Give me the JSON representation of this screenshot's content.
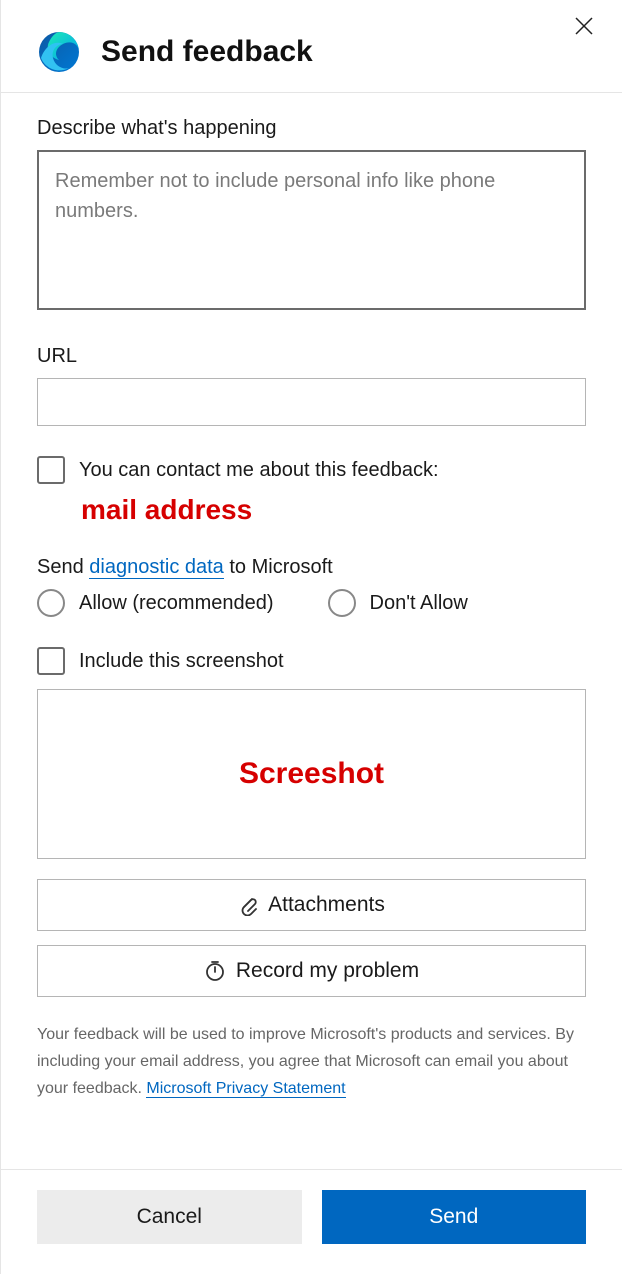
{
  "header": {
    "title": "Send feedback"
  },
  "describe": {
    "label": "Describe what's happening",
    "placeholder": "Remember not to include personal info like phone numbers."
  },
  "url": {
    "label": "URL",
    "value": ""
  },
  "contact": {
    "label": "You can contact me about this feedback:",
    "annotation": "mail address"
  },
  "diagnostic": {
    "prefix": "Send ",
    "link": "diagnostic data",
    "suffix": " to Microsoft",
    "allow": "Allow (recommended)",
    "dont_allow": "Don't Allow"
  },
  "screenshot": {
    "label": "Include this screenshot",
    "annotation": "Screeshot"
  },
  "attachments": {
    "label": "Attachments"
  },
  "record": {
    "label": "Record my problem"
  },
  "disclaimer": {
    "text": "Your feedback will be used to improve Microsoft's products and services. By including your email address, you agree that Microsoft can email you about your feedback. ",
    "link": "Microsoft Privacy Statement"
  },
  "actions": {
    "cancel": "Cancel",
    "send": "Send"
  }
}
